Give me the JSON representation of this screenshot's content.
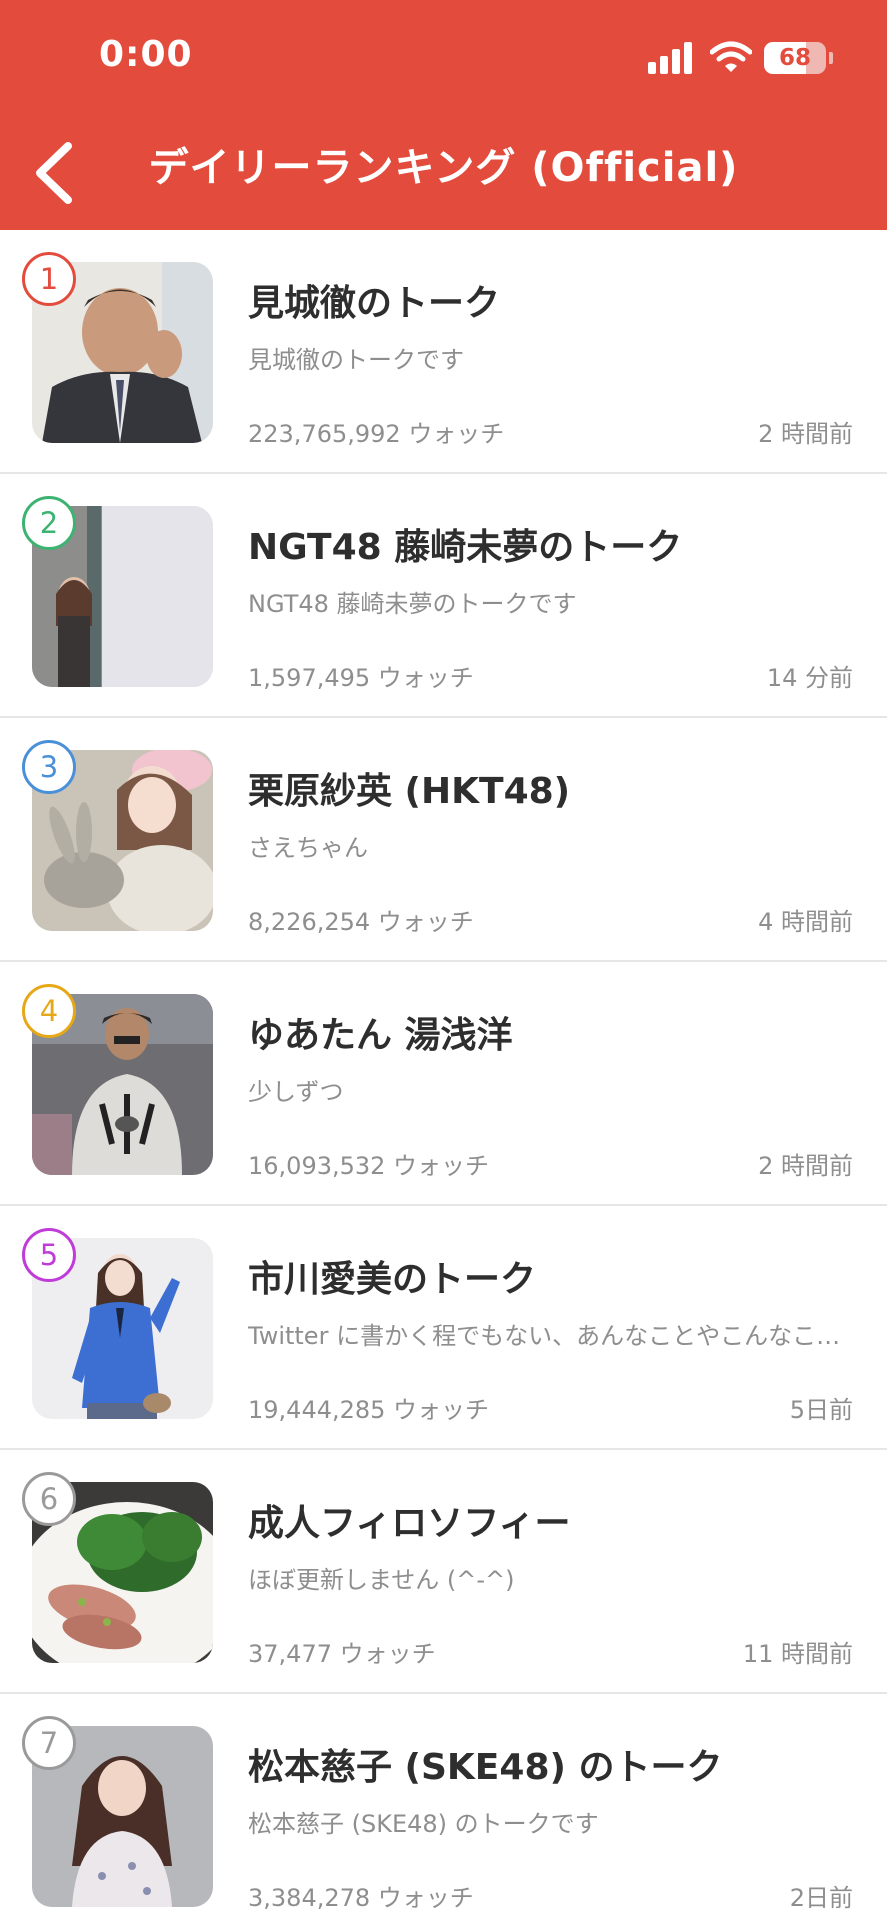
{
  "status_bar": {
    "time": "0:00",
    "battery": "68",
    "battery_level": 0.68
  },
  "header": {
    "title": "デイリーランキング (Official)"
  },
  "items": [
    {
      "rank": "1",
      "rank_color": "#e34b3c",
      "name": "見城徹のトーク",
      "desc": "見城徹のトークです",
      "watch": "223,765,992 ウォッチ",
      "ago": "2 時間前"
    },
    {
      "rank": "2",
      "rank_color": "#3cb371",
      "name": "NGT48 藤崎未夢のトーク",
      "desc": "NGT48 藤崎未夢のトークです",
      "watch": "1,597,495 ウォッチ",
      "ago": "14 分前"
    },
    {
      "rank": "3",
      "rank_color": "#4a90d9",
      "name": "栗原紗英 (HKT48)",
      "desc": "さえちゃん",
      "watch": "8,226,254 ウォッチ",
      "ago": "4 時間前"
    },
    {
      "rank": "4",
      "rank_color": "#e6a817",
      "name": "ゆあたん 湯浅洋",
      "desc": "少しずつ",
      "watch": "16,093,532 ウォッチ",
      "ago": "2 時間前"
    },
    {
      "rank": "5",
      "rank_color": "#c03cd8",
      "name": "市川愛美のトーク",
      "desc": "Twitter に書かく程でもない、あんなことやこんなことをつぶやきます",
      "watch": "19,444,285 ウォッチ",
      "ago": "5日前"
    },
    {
      "rank": "6",
      "rank_color": "#9a9a9a",
      "name": "成人フィロソフィー",
      "desc": "ほぼ更新しません (^-^)",
      "watch": "37,477 ウォッチ",
      "ago": "11 時間前"
    },
    {
      "rank": "7",
      "rank_color": "#9a9a9a",
      "name": "松本慈子 (SKE48) のトーク",
      "desc": "松本慈子 (SKE48) のトークです",
      "watch": "3,384,278 ウォッチ",
      "ago": "2日前"
    }
  ]
}
